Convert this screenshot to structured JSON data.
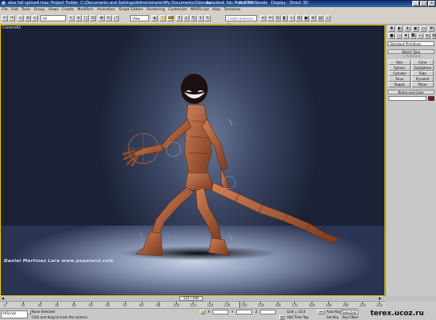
{
  "window": {
    "file_title": "alex fall spline4.max",
    "project": "Project Folder: C:\\Documents and Settings\\Administrator\\My Documents\\3dsmax",
    "app": "Autodesk 3ds Max  2009",
    "resale": "Not for Resale",
    "display": "Display : Direct 3D"
  },
  "menu": [
    "File",
    "Edit",
    "Tools",
    "Group",
    "Views",
    "Create",
    "Modifiers",
    "Animation",
    "Graph Editors",
    "Rendering",
    "Customize",
    "MAXScript",
    "Help",
    "Tentacles"
  ],
  "toolbar": {
    "filter_value": "All",
    "ref_coord_value": "View",
    "selection_set_placeholder": "Create Selection Se"
  },
  "viewport": {
    "label": "Camera01",
    "watermark": "Daniel Martinez Lara   www.pepeland.com"
  },
  "command_panel": {
    "category_dropdown": "Standard Primitives",
    "object_type_title": "Object Type",
    "autogrid_label": "AutoGrid",
    "objects": [
      "Box",
      "Cone",
      "Sphere",
      "GeoSphere",
      "Cylinder",
      "Tube",
      "Torus",
      "Pyramid",
      "Teapot",
      "Plane"
    ],
    "name_color_title": "Name and Color"
  },
  "timeline": {
    "frame_readout": "125 / 200",
    "ticks": [
      "0",
      "10",
      "20",
      "30",
      "40",
      "50",
      "60",
      "70",
      "80",
      "90",
      "100",
      "110",
      "120",
      "130",
      "140",
      "150",
      "160",
      "170",
      "180",
      "190",
      "200",
      "210",
      "220"
    ],
    "current_frame_fraction": 0.625
  },
  "status": {
    "maxscript_label": "AXScript.",
    "selection_status": "None Selected",
    "prompt": "Click and drag to truck the camera",
    "grid": "Grid = 10,0",
    "add_time_tag": "Add Time Tag",
    "auto_key": "Auto Key",
    "selected_dropdown": "Selected",
    "set_key": "Set Key",
    "key_filters": "Key Filters..."
  },
  "overlay": {
    "site": "terex.ucoz.ru"
  },
  "colors": {
    "viewport_border": "#f0d000",
    "character": "#b5643c",
    "title_bar": "#0a246a"
  }
}
